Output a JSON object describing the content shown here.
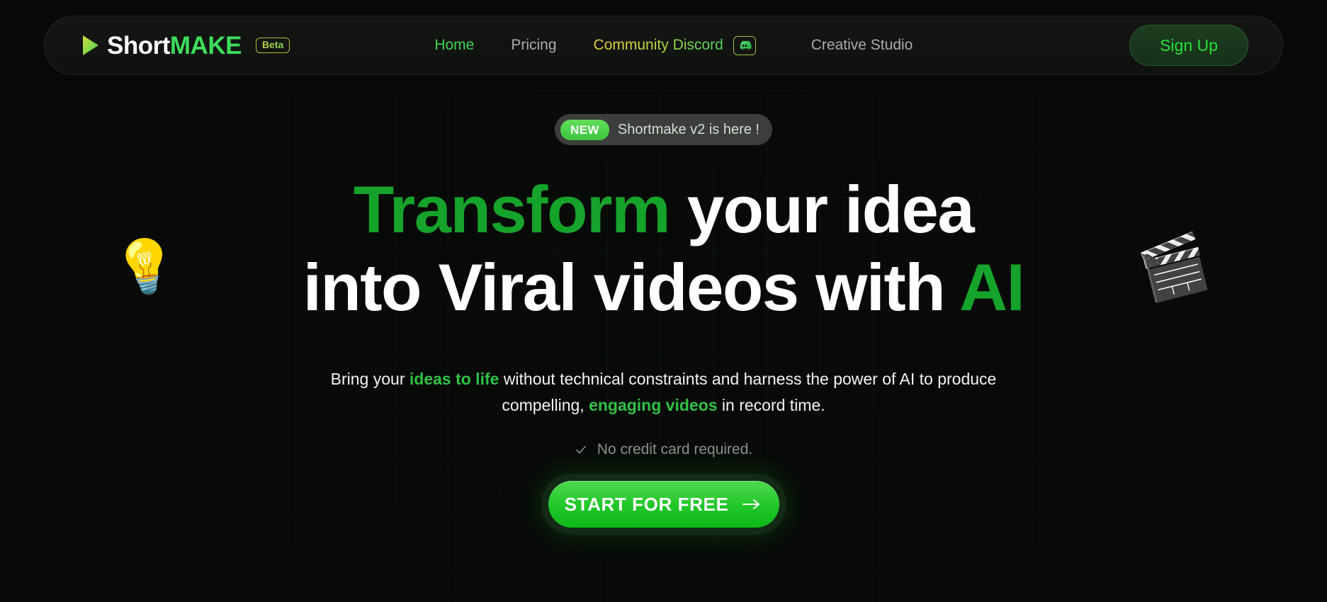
{
  "brand": {
    "play_icon": "play-triangle-icon",
    "name_part1": "Short",
    "name_part2": "MAKE",
    "badge": "Beta"
  },
  "nav": {
    "items": [
      {
        "label": "Home",
        "state": "active",
        "color": "#3fd44f"
      },
      {
        "label": "Pricing",
        "state": "default",
        "color": "#a9abaa"
      },
      {
        "label": "Community Discord",
        "state": "gradient",
        "icon": "discord-icon"
      },
      {
        "label": "Creative Studio",
        "state": "default",
        "color": "#a9abaa"
      }
    ],
    "signup_label": "Sign Up"
  },
  "announcement": {
    "badge": "NEW",
    "text": "Shortmake v2 is here !"
  },
  "hero": {
    "line1_green": "Transform",
    "line1_white": "your idea",
    "line2_white": "into Viral videos with",
    "line2_green": "AI",
    "emoji_left": "💡",
    "emoji_right": "🎬",
    "subtitle": {
      "seg1": "Bring your ",
      "seg2_green": "ideas to life",
      "seg3": " without technical constraints and harness the power of AI to produce compelling, ",
      "seg4_green": "engaging videos",
      "seg5": " in record time."
    },
    "no_card_text": "No credit card required.",
    "check_icon": "check-icon",
    "cta_label": "START FOR FREE",
    "cta_arrow": "arrow-right-icon"
  },
  "colors": {
    "page_bg": "#080a08",
    "header_bg": "#121412",
    "accent_green": "#21c82a",
    "bright_green": "#3fd44f",
    "heading_green": "#16a32b",
    "gradient_yellow": "#e3cf3c",
    "muted_text": "#a9abaa",
    "grid_line": "#2e7838"
  }
}
